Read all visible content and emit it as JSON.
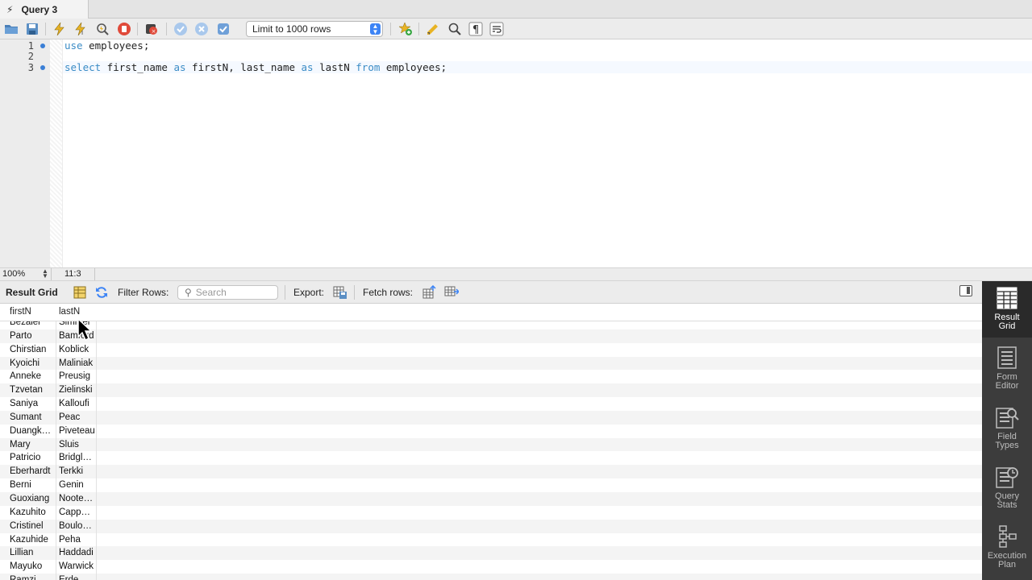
{
  "tab": {
    "title": "Query 3"
  },
  "toolbar": {
    "limit_select": "Limit to 1000 rows"
  },
  "editor": {
    "lines": [
      {
        "num": "1",
        "has_dot": true
      },
      {
        "num": "2",
        "has_dot": false
      },
      {
        "num": "3",
        "has_dot": true
      }
    ],
    "line1": {
      "kw": "use",
      "rest": " employees;"
    },
    "line3": {
      "kw1": "select",
      "p1": " first_name ",
      "kw2": "as",
      "p2": " firstN, last_name ",
      "kw3": "as",
      "p3": " lastN ",
      "kw4": "from",
      "p4": " employees;"
    }
  },
  "status": {
    "zoom": "100%",
    "cursor_pos": "11:3"
  },
  "result_toolbar": {
    "title": "Result Grid",
    "filter_label": "Filter Rows:",
    "search_placeholder": "Search",
    "export_label": "Export:",
    "fetch_label": "Fetch rows:"
  },
  "grid": {
    "columns": [
      "firstN",
      "lastN"
    ],
    "rows": [
      [
        "Bezalel",
        "Simmel"
      ],
      [
        "Parto",
        "Bamford"
      ],
      [
        "Chirstian",
        "Koblick"
      ],
      [
        "Kyoichi",
        "Maliniak"
      ],
      [
        "Anneke",
        "Preusig"
      ],
      [
        "Tzvetan",
        "Zielinski"
      ],
      [
        "Saniya",
        "Kalloufi"
      ],
      [
        "Sumant",
        "Peac"
      ],
      [
        "Duangk…",
        "Piveteau"
      ],
      [
        "Mary",
        "Sluis"
      ],
      [
        "Patricio",
        "Bridgl…"
      ],
      [
        "Eberhardt",
        "Terkki"
      ],
      [
        "Berni",
        "Genin"
      ],
      [
        "Guoxiang",
        "Noote…"
      ],
      [
        "Kazuhito",
        "Capp…"
      ],
      [
        "Cristinel",
        "Boulo…"
      ],
      [
        "Kazuhide",
        "Peha"
      ],
      [
        "Lillian",
        "Haddadi"
      ],
      [
        "Mayuko",
        "Warwick"
      ],
      [
        "Ramzi",
        "Erde"
      ]
    ]
  },
  "side_panel": {
    "buttons": [
      {
        "label1": "Result",
        "label2": "Grid",
        "active": true
      },
      {
        "label1": "Form",
        "label2": "Editor",
        "active": false
      },
      {
        "label1": "Field",
        "label2": "Types",
        "active": false
      },
      {
        "label1": "Query",
        "label2": "Stats",
        "active": false
      },
      {
        "label1": "Execution",
        "label2": "Plan",
        "active": false
      }
    ]
  },
  "colors": {
    "keyword": "#3b8cc6",
    "accent": "#3d84f5",
    "panel_bg": "#3c3c3c"
  }
}
